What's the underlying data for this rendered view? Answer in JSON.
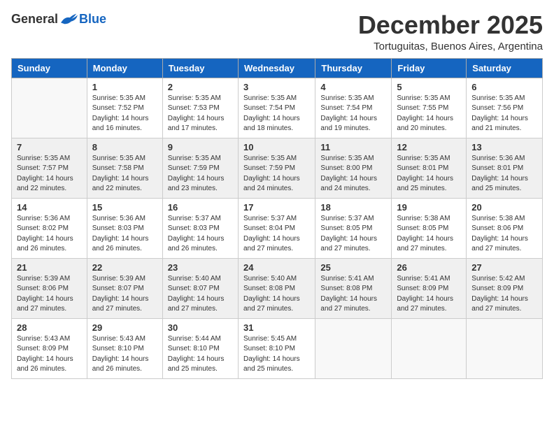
{
  "header": {
    "logo_general": "General",
    "logo_blue": "Blue",
    "month_title": "December 2025",
    "location": "Tortuguitas, Buenos Aires, Argentina"
  },
  "days_of_week": [
    "Sunday",
    "Monday",
    "Tuesday",
    "Wednesday",
    "Thursday",
    "Friday",
    "Saturday"
  ],
  "weeks": [
    [
      {
        "day": "",
        "sunrise": "",
        "sunset": "",
        "daylight": "",
        "empty": true
      },
      {
        "day": "1",
        "sunrise": "Sunrise: 5:35 AM",
        "sunset": "Sunset: 7:52 PM",
        "daylight": "Daylight: 14 hours and 16 minutes.",
        "empty": false
      },
      {
        "day": "2",
        "sunrise": "Sunrise: 5:35 AM",
        "sunset": "Sunset: 7:53 PM",
        "daylight": "Daylight: 14 hours and 17 minutes.",
        "empty": false
      },
      {
        "day": "3",
        "sunrise": "Sunrise: 5:35 AM",
        "sunset": "Sunset: 7:54 PM",
        "daylight": "Daylight: 14 hours and 18 minutes.",
        "empty": false
      },
      {
        "day": "4",
        "sunrise": "Sunrise: 5:35 AM",
        "sunset": "Sunset: 7:54 PM",
        "daylight": "Daylight: 14 hours and 19 minutes.",
        "empty": false
      },
      {
        "day": "5",
        "sunrise": "Sunrise: 5:35 AM",
        "sunset": "Sunset: 7:55 PM",
        "daylight": "Daylight: 14 hours and 20 minutes.",
        "empty": false
      },
      {
        "day": "6",
        "sunrise": "Sunrise: 5:35 AM",
        "sunset": "Sunset: 7:56 PM",
        "daylight": "Daylight: 14 hours and 21 minutes.",
        "empty": false
      }
    ],
    [
      {
        "day": "7",
        "sunrise": "Sunrise: 5:35 AM",
        "sunset": "Sunset: 7:57 PM",
        "daylight": "Daylight: 14 hours and 22 minutes.",
        "empty": false
      },
      {
        "day": "8",
        "sunrise": "Sunrise: 5:35 AM",
        "sunset": "Sunset: 7:58 PM",
        "daylight": "Daylight: 14 hours and 22 minutes.",
        "empty": false
      },
      {
        "day": "9",
        "sunrise": "Sunrise: 5:35 AM",
        "sunset": "Sunset: 7:59 PM",
        "daylight": "Daylight: 14 hours and 23 minutes.",
        "empty": false
      },
      {
        "day": "10",
        "sunrise": "Sunrise: 5:35 AM",
        "sunset": "Sunset: 7:59 PM",
        "daylight": "Daylight: 14 hours and 24 minutes.",
        "empty": false
      },
      {
        "day": "11",
        "sunrise": "Sunrise: 5:35 AM",
        "sunset": "Sunset: 8:00 PM",
        "daylight": "Daylight: 14 hours and 24 minutes.",
        "empty": false
      },
      {
        "day": "12",
        "sunrise": "Sunrise: 5:35 AM",
        "sunset": "Sunset: 8:01 PM",
        "daylight": "Daylight: 14 hours and 25 minutes.",
        "empty": false
      },
      {
        "day": "13",
        "sunrise": "Sunrise: 5:36 AM",
        "sunset": "Sunset: 8:01 PM",
        "daylight": "Daylight: 14 hours and 25 minutes.",
        "empty": false
      }
    ],
    [
      {
        "day": "14",
        "sunrise": "Sunrise: 5:36 AM",
        "sunset": "Sunset: 8:02 PM",
        "daylight": "Daylight: 14 hours and 26 minutes.",
        "empty": false
      },
      {
        "day": "15",
        "sunrise": "Sunrise: 5:36 AM",
        "sunset": "Sunset: 8:03 PM",
        "daylight": "Daylight: 14 hours and 26 minutes.",
        "empty": false
      },
      {
        "day": "16",
        "sunrise": "Sunrise: 5:37 AM",
        "sunset": "Sunset: 8:03 PM",
        "daylight": "Daylight: 14 hours and 26 minutes.",
        "empty": false
      },
      {
        "day": "17",
        "sunrise": "Sunrise: 5:37 AM",
        "sunset": "Sunset: 8:04 PM",
        "daylight": "Daylight: 14 hours and 27 minutes.",
        "empty": false
      },
      {
        "day": "18",
        "sunrise": "Sunrise: 5:37 AM",
        "sunset": "Sunset: 8:05 PM",
        "daylight": "Daylight: 14 hours and 27 minutes.",
        "empty": false
      },
      {
        "day": "19",
        "sunrise": "Sunrise: 5:38 AM",
        "sunset": "Sunset: 8:05 PM",
        "daylight": "Daylight: 14 hours and 27 minutes.",
        "empty": false
      },
      {
        "day": "20",
        "sunrise": "Sunrise: 5:38 AM",
        "sunset": "Sunset: 8:06 PM",
        "daylight": "Daylight: 14 hours and 27 minutes.",
        "empty": false
      }
    ],
    [
      {
        "day": "21",
        "sunrise": "Sunrise: 5:39 AM",
        "sunset": "Sunset: 8:06 PM",
        "daylight": "Daylight: 14 hours and 27 minutes.",
        "empty": false
      },
      {
        "day": "22",
        "sunrise": "Sunrise: 5:39 AM",
        "sunset": "Sunset: 8:07 PM",
        "daylight": "Daylight: 14 hours and 27 minutes.",
        "empty": false
      },
      {
        "day": "23",
        "sunrise": "Sunrise: 5:40 AM",
        "sunset": "Sunset: 8:07 PM",
        "daylight": "Daylight: 14 hours and 27 minutes.",
        "empty": false
      },
      {
        "day": "24",
        "sunrise": "Sunrise: 5:40 AM",
        "sunset": "Sunset: 8:08 PM",
        "daylight": "Daylight: 14 hours and 27 minutes.",
        "empty": false
      },
      {
        "day": "25",
        "sunrise": "Sunrise: 5:41 AM",
        "sunset": "Sunset: 8:08 PM",
        "daylight": "Daylight: 14 hours and 27 minutes.",
        "empty": false
      },
      {
        "day": "26",
        "sunrise": "Sunrise: 5:41 AM",
        "sunset": "Sunset: 8:09 PM",
        "daylight": "Daylight: 14 hours and 27 minutes.",
        "empty": false
      },
      {
        "day": "27",
        "sunrise": "Sunrise: 5:42 AM",
        "sunset": "Sunset: 8:09 PM",
        "daylight": "Daylight: 14 hours and 27 minutes.",
        "empty": false
      }
    ],
    [
      {
        "day": "28",
        "sunrise": "Sunrise: 5:43 AM",
        "sunset": "Sunset: 8:09 PM",
        "daylight": "Daylight: 14 hours and 26 minutes.",
        "empty": false
      },
      {
        "day": "29",
        "sunrise": "Sunrise: 5:43 AM",
        "sunset": "Sunset: 8:10 PM",
        "daylight": "Daylight: 14 hours and 26 minutes.",
        "empty": false
      },
      {
        "day": "30",
        "sunrise": "Sunrise: 5:44 AM",
        "sunset": "Sunset: 8:10 PM",
        "daylight": "Daylight: 14 hours and 25 minutes.",
        "empty": false
      },
      {
        "day": "31",
        "sunrise": "Sunrise: 5:45 AM",
        "sunset": "Sunset: 8:10 PM",
        "daylight": "Daylight: 14 hours and 25 minutes.",
        "empty": false
      },
      {
        "day": "",
        "sunrise": "",
        "sunset": "",
        "daylight": "",
        "empty": true
      },
      {
        "day": "",
        "sunrise": "",
        "sunset": "",
        "daylight": "",
        "empty": true
      },
      {
        "day": "",
        "sunrise": "",
        "sunset": "",
        "daylight": "",
        "empty": true
      }
    ]
  ]
}
